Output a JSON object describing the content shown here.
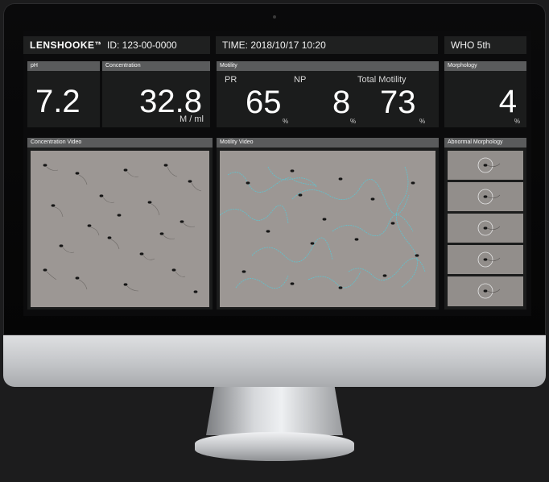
{
  "header": {
    "logo_text": "LENSHOOKE",
    "logo_tm": "™",
    "id_text": "ID: 123-00-0000",
    "time_text": "TIME:  2018/10/17   10:20",
    "standard_text": "WHO 5th"
  },
  "tiles": {
    "ph": {
      "label": "pH",
      "value": "7.2"
    },
    "concentration": {
      "label": "Concentration",
      "value": "32.8",
      "unit": "M / ml"
    },
    "motility": {
      "label": "Motility",
      "pr_label": "PR",
      "pr_value": "65",
      "pr_unit": "%",
      "np_label": "NP",
      "np_value": "8",
      "np_unit": "%",
      "total_label": "Total Motility",
      "total_value": "73",
      "total_unit": "%"
    },
    "morphology": {
      "label": "Morphology",
      "value": "4",
      "unit": "%"
    }
  },
  "videos": {
    "concentration_label": "Concentration Video",
    "motility_label": "Motility Video",
    "abnormal_label": "Abnormal Morphology"
  },
  "colors": {
    "screen_bg": "#0b0b0c",
    "tile_bg": "#1b1c1c",
    "label_bar": "#5a5b5c",
    "video_bg": "#9c9794",
    "track": "#5fc3cf",
    "sperm_head": "#151515"
  }
}
